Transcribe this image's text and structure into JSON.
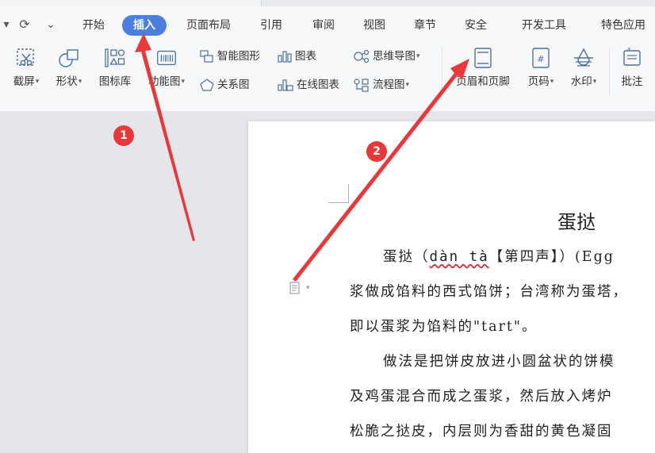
{
  "quick_access": {
    "left_caret": "▾",
    "redo": "⟳",
    "more": "⌄"
  },
  "menu": {
    "tabs": [
      "开始",
      "插入",
      "页面布局",
      "引用",
      "审阅",
      "视图",
      "章节",
      "安全",
      "开发工具",
      "特色应用"
    ],
    "active_tab": "插入"
  },
  "ribbon": {
    "screenshot": "截屏",
    "shape": "形状",
    "icon_library": "图标库",
    "function_chart": "功能图",
    "smart_art": "智能图形",
    "chart": "图表",
    "mind_map": "思维导图",
    "relation_chart": "关系图",
    "online_chart": "在线图表",
    "flow_chart": "流程图",
    "header_footer": "页眉和页脚",
    "page_number": "页码",
    "watermark": "水印",
    "comment": "批注"
  },
  "document": {
    "title": "蛋挞",
    "lines": [
      {
        "a": "蛋挞（",
        "b": "dàn tà",
        "c": "【第四声】）(Egg"
      },
      {
        "text": "浆做成馅料的西式馅饼；台湾称为蛋塔，"
      },
      {
        "text": "即以蛋浆为馅料的\"tart\"。"
      },
      {
        "text": "做法是把饼皮放进小圆盆状的饼模"
      },
      {
        "text": "及鸡蛋混合而成之蛋浆，然后放入烤炉"
      },
      {
        "text": "松脆之挞皮，内层则为香甜的黄色凝固"
      }
    ]
  },
  "annotations": {
    "badge_1": "1",
    "badge_2": "2",
    "color": "#e8383a"
  },
  "colors": {
    "accent": "#4a7fe0",
    "icon": "#4a6fa5",
    "page": "#ffffff",
    "canvas": "#e4e6ea"
  }
}
